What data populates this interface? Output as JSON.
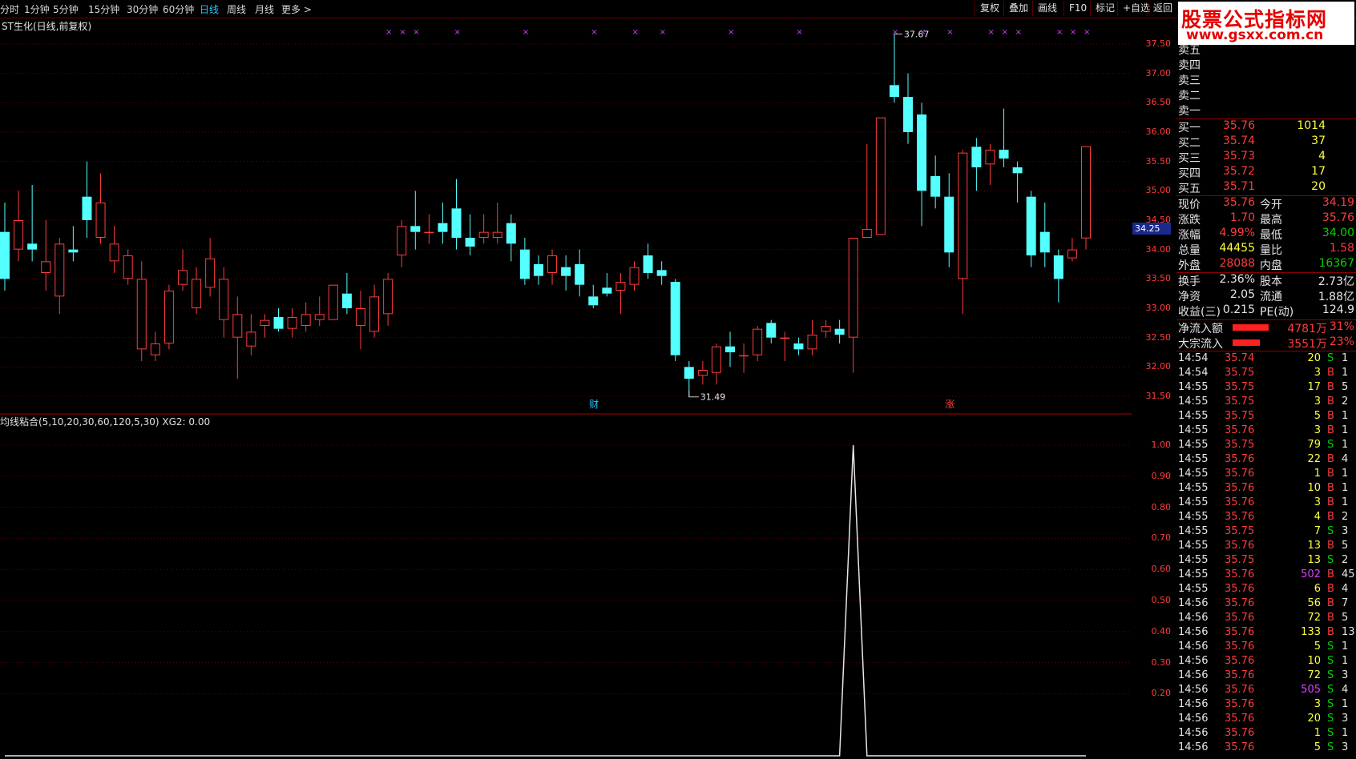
{
  "colors": {
    "up": "#ff3c3c",
    "down": "#54ffff",
    "grid": "#6b0000",
    "accent": "#1ec8ff",
    "bg": "#000000"
  },
  "toolbar": {
    "periods": [
      "分时",
      "1分钟",
      "5分钟",
      "15分钟",
      "30分钟",
      "60分钟",
      "日线",
      "周线",
      "月线",
      "更多 >"
    ],
    "active_period": "日线",
    "right_buttons": [
      "复权",
      "叠加",
      "画线",
      "F10",
      "标记",
      "+自选",
      "返回"
    ]
  },
  "chart_title": "ST生化(日线,前复权)",
  "main_chart": {
    "y_axis_labels": [
      "37.50",
      "37.00",
      "36.50",
      "36.00",
      "35.50",
      "35.00",
      "34.50",
      "34.00",
      "33.50",
      "33.00",
      "32.50",
      "32.00",
      "31.50"
    ],
    "current_price_tag": "34.25",
    "high_mark": "37.67",
    "low_mark": "31.49",
    "event_markers": [
      "财",
      "涨"
    ],
    "marker_glyph": "×"
  },
  "chart_data": [
    {
      "type": "candlestick",
      "ylim": [
        31.2,
        38.1
      ],
      "candles": [
        [
          34.3,
          33.5,
          34.8,
          33.3
        ],
        [
          34.0,
          34.5,
          35.0,
          33.8
        ],
        [
          34.1,
          34.0,
          35.1,
          33.8
        ],
        [
          33.6,
          33.8,
          34.5,
          33.3
        ],
        [
          33.2,
          34.1,
          34.2,
          32.9
        ],
        [
          34.0,
          33.95,
          34.4,
          33.8
        ],
        [
          34.9,
          34.5,
          35.5,
          34.2
        ],
        [
          34.2,
          34.8,
          35.3,
          34.1
        ],
        [
          33.8,
          34.1,
          34.4,
          33.6
        ],
        [
          33.5,
          33.9,
          34.0,
          33.4
        ],
        [
          32.3,
          33.5,
          33.8,
          32.1
        ],
        [
          32.2,
          32.4,
          32.6,
          32.1
        ],
        [
          32.4,
          33.3,
          33.4,
          32.3
        ],
        [
          33.4,
          33.65,
          34.0,
          33.3
        ],
        [
          33.0,
          33.5,
          33.7,
          32.9
        ],
        [
          33.35,
          33.85,
          34.2,
          33.2
        ],
        [
          32.8,
          33.5,
          33.7,
          32.5
        ],
        [
          32.5,
          32.9,
          33.2,
          31.8
        ],
        [
          32.35,
          32.6,
          32.9,
          32.2
        ],
        [
          32.7,
          32.8,
          32.9,
          32.5
        ],
        [
          32.85,
          32.65,
          33.0,
          32.6
        ],
        [
          32.65,
          32.85,
          33.0,
          32.5
        ],
        [
          32.7,
          32.9,
          33.1,
          32.6
        ],
        [
          32.8,
          32.9,
          33.2,
          32.7
        ],
        [
          32.8,
          33.4,
          33.4,
          32.8
        ],
        [
          33.25,
          33.0,
          33.6,
          32.9
        ],
        [
          32.7,
          33.0,
          33.3,
          32.3
        ],
        [
          32.6,
          33.2,
          33.4,
          32.5
        ],
        [
          32.9,
          33.5,
          33.6,
          32.7
        ],
        [
          33.9,
          34.4,
          34.5,
          33.7
        ],
        [
          34.4,
          34.3,
          35.0,
          34.0
        ],
        [
          34.3,
          34.3,
          34.6,
          34.1
        ],
        [
          34.45,
          34.3,
          34.8,
          34.1
        ],
        [
          34.7,
          34.2,
          35.2,
          34.0
        ],
        [
          34.2,
          34.05,
          34.6,
          33.9
        ],
        [
          34.2,
          34.3,
          34.6,
          34.1
        ],
        [
          34.2,
          34.3,
          34.8,
          34.1
        ],
        [
          34.45,
          34.1,
          34.6,
          33.8
        ],
        [
          34.0,
          33.5,
          34.2,
          33.4
        ],
        [
          33.75,
          33.55,
          33.9,
          33.4
        ],
        [
          33.6,
          33.9,
          34.0,
          33.4
        ],
        [
          33.7,
          33.55,
          33.9,
          33.3
        ],
        [
          33.75,
          33.4,
          34.0,
          33.2
        ],
        [
          33.2,
          33.05,
          33.4,
          33.0
        ],
        [
          33.35,
          33.25,
          33.6,
          33.2
        ],
        [
          33.3,
          33.45,
          33.6,
          32.9
        ],
        [
          33.4,
          33.7,
          33.8,
          33.3
        ],
        [
          33.9,
          33.6,
          34.1,
          33.5
        ],
        [
          33.65,
          33.55,
          33.8,
          33.4
        ],
        [
          33.45,
          32.2,
          33.5,
          32.1
        ],
        [
          32.0,
          31.8,
          32.1,
          31.49
        ],
        [
          31.85,
          31.95,
          32.1,
          31.7
        ],
        [
          31.9,
          32.35,
          32.4,
          31.7
        ],
        [
          32.35,
          32.25,
          32.6,
          32.0
        ],
        [
          32.2,
          32.2,
          32.4,
          31.9
        ],
        [
          32.2,
          32.65,
          32.7,
          32.1
        ],
        [
          32.75,
          32.5,
          32.8,
          32.4
        ],
        [
          32.5,
          32.5,
          32.6,
          32.1
        ],
        [
          32.4,
          32.3,
          32.5,
          32.2
        ],
        [
          32.3,
          32.55,
          32.8,
          32.2
        ],
        [
          32.6,
          32.7,
          32.8,
          32.5
        ],
        [
          32.65,
          32.55,
          32.8,
          32.4
        ],
        [
          32.5,
          34.2,
          34.2,
          31.9
        ],
        [
          34.2,
          34.35,
          35.8,
          34.2
        ],
        [
          34.25,
          36.25,
          36.25,
          34.25
        ],
        [
          36.8,
          36.6,
          37.67,
          36.5
        ],
        [
          36.6,
          36.0,
          37.0,
          35.8
        ],
        [
          36.3,
          35.0,
          36.5,
          34.4
        ],
        [
          35.25,
          34.9,
          35.6,
          34.7
        ],
        [
          34.9,
          33.95,
          35.3,
          33.7
        ],
        [
          33.5,
          35.65,
          35.7,
          32.9
        ],
        [
          35.75,
          35.4,
          35.9,
          35.0
        ],
        [
          35.45,
          35.7,
          35.8,
          35.1
        ],
        [
          35.7,
          35.55,
          36.4,
          35.4
        ],
        [
          35.4,
          35.3,
          35.5,
          34.8
        ],
        [
          34.9,
          33.9,
          35.0,
          33.7
        ],
        [
          34.3,
          33.95,
          34.8,
          33.7
        ],
        [
          33.9,
          33.5,
          34.0,
          33.1
        ],
        [
          33.85,
          34.0,
          34.2,
          33.8
        ],
        [
          34.19,
          35.76,
          35.76,
          34.0
        ]
      ]
    },
    {
      "type": "line",
      "name": "XG2",
      "ylim": [
        0,
        1.05
      ],
      "values": [
        0,
        0,
        0,
        0,
        0,
        0,
        0,
        0,
        0,
        0,
        0,
        0,
        0,
        0,
        0,
        0,
        0,
        0,
        0,
        0,
        0,
        0,
        0,
        0,
        0,
        0,
        0,
        0,
        0,
        0,
        0,
        0,
        0,
        0,
        0,
        0,
        0,
        0,
        0,
        0,
        0,
        0,
        0,
        0,
        0,
        0,
        0,
        0,
        0,
        0,
        0,
        0,
        0,
        0,
        0,
        0,
        0,
        0,
        0,
        0,
        0,
        0,
        1,
        0,
        0,
        0,
        0,
        0,
        0,
        0,
        0,
        0,
        0,
        0,
        0,
        0,
        0,
        0,
        0,
        0
      ]
    }
  ],
  "indicator": {
    "label": "均线粘合(5,10,20,30,60,120,5,30)  XG2: 0.00",
    "y_axis_labels": [
      "1.00",
      "0.90",
      "0.80",
      "0.70",
      "0.60",
      "0.50",
      "0.40",
      "0.30",
      "0.20"
    ]
  },
  "order_book": {
    "asks": [
      {
        "label": "卖五"
      },
      {
        "label": "卖四"
      },
      {
        "label": "卖三"
      },
      {
        "label": "卖二"
      },
      {
        "label": "卖一"
      }
    ],
    "bids": [
      {
        "label": "买一",
        "price": "35.76",
        "vol": "1014"
      },
      {
        "label": "买二",
        "price": "35.74",
        "vol": "37"
      },
      {
        "label": "买三",
        "price": "35.73",
        "vol": "4"
      },
      {
        "label": "买四",
        "price": "35.72",
        "vol": "17"
      },
      {
        "label": "买五",
        "price": "35.71",
        "vol": "20"
      }
    ]
  },
  "quote": [
    {
      "l1": "现价",
      "v1": "35.76",
      "l2": "今开",
      "v2": "34.19"
    },
    {
      "l1": "涨跌",
      "v1": "1.70",
      "l2": "最高",
      "v2": "35.76"
    },
    {
      "l1": "涨幅",
      "v1": "4.99%",
      "l2": "最低",
      "v2": "34.00"
    },
    {
      "l1": "总量",
      "v1": "44455",
      "l2": "量比",
      "v2": "1.58"
    },
    {
      "l1": "外盘",
      "v1": "28088",
      "l2": "内盘",
      "v2": "16367"
    }
  ],
  "fundamentals": [
    {
      "l1": "换手",
      "v1": "2.36%",
      "l2": "股本",
      "v2": "2.73亿"
    },
    {
      "l1": "净资",
      "v1": "2.05",
      "l2": "流通",
      "v2": "1.88亿"
    },
    {
      "l1": "收益(三)",
      "v1": "0.215",
      "l2": "PE(动)",
      "v2": "124.9"
    }
  ],
  "flows": [
    {
      "label": "净流入额",
      "value": "4781万",
      "pct": "31%",
      "bar_ratio": 0.31
    },
    {
      "label": "大宗流入",
      "value": "3551万",
      "pct": "23%",
      "bar_ratio": 0.23
    }
  ],
  "ticks": [
    {
      "time": "14:54",
      "price": "35.74",
      "vol": "20",
      "side": "S",
      "n": "1"
    },
    {
      "time": "14:54",
      "price": "35.75",
      "vol": "3",
      "side": "B",
      "n": "1"
    },
    {
      "time": "14:55",
      "price": "35.75",
      "vol": "17",
      "side": "B",
      "n": "5"
    },
    {
      "time": "14:55",
      "price": "35.75",
      "vol": "3",
      "side": "B",
      "n": "2"
    },
    {
      "time": "14:55",
      "price": "35.75",
      "vol": "5",
      "side": "B",
      "n": "1"
    },
    {
      "time": "14:55",
      "price": "35.76",
      "vol": "3",
      "side": "B",
      "n": "1"
    },
    {
      "time": "14:55",
      "price": "35.75",
      "vol": "79",
      "side": "S",
      "n": "1"
    },
    {
      "time": "14:55",
      "price": "35.76",
      "vol": "22",
      "side": "B",
      "n": "4"
    },
    {
      "time": "14:55",
      "price": "35.76",
      "vol": "1",
      "side": "B",
      "n": "1"
    },
    {
      "time": "14:55",
      "price": "35.76",
      "vol": "10",
      "side": "B",
      "n": "1"
    },
    {
      "time": "14:55",
      "price": "35.76",
      "vol": "3",
      "side": "B",
      "n": "1"
    },
    {
      "time": "14:55",
      "price": "35.76",
      "vol": "4",
      "side": "B",
      "n": "2"
    },
    {
      "time": "14:55",
      "price": "35.75",
      "vol": "7",
      "side": "S",
      "n": "3"
    },
    {
      "time": "14:55",
      "price": "35.76",
      "vol": "13",
      "side": "B",
      "n": "5"
    },
    {
      "time": "14:55",
      "price": "35.75",
      "vol": "13",
      "side": "S",
      "n": "2"
    },
    {
      "time": "14:55",
      "price": "35.76",
      "vol": "502",
      "side": "B",
      "n": "45"
    },
    {
      "time": "14:55",
      "price": "35.76",
      "vol": "6",
      "side": "B",
      "n": "4"
    },
    {
      "time": "14:56",
      "price": "35.76",
      "vol": "56",
      "side": "B",
      "n": "7"
    },
    {
      "time": "14:56",
      "price": "35.76",
      "vol": "72",
      "side": "B",
      "n": "5"
    },
    {
      "time": "14:56",
      "price": "35.76",
      "vol": "133",
      "side": "B",
      "n": "13"
    },
    {
      "time": "14:56",
      "price": "35.76",
      "vol": "5",
      "side": "S",
      "n": "1"
    },
    {
      "time": "14:56",
      "price": "35.76",
      "vol": "10",
      "side": "S",
      "n": "1"
    },
    {
      "time": "14:56",
      "price": "35.76",
      "vol": "72",
      "side": "S",
      "n": "3"
    },
    {
      "time": "14:56",
      "price": "35.76",
      "vol": "505",
      "side": "S",
      "n": "4"
    },
    {
      "time": "14:56",
      "price": "35.76",
      "vol": "3",
      "side": "S",
      "n": "1"
    },
    {
      "time": "14:56",
      "price": "35.76",
      "vol": "20",
      "side": "S",
      "n": "3"
    },
    {
      "time": "14:56",
      "price": "35.76",
      "vol": "1",
      "side": "S",
      "n": "1"
    },
    {
      "time": "14:56",
      "price": "35.76",
      "vol": "5",
      "side": "S",
      "n": "3"
    }
  ],
  "watermark": {
    "line1": "股票公式指标网",
    "line2": "www.gsxx.com.cn"
  }
}
